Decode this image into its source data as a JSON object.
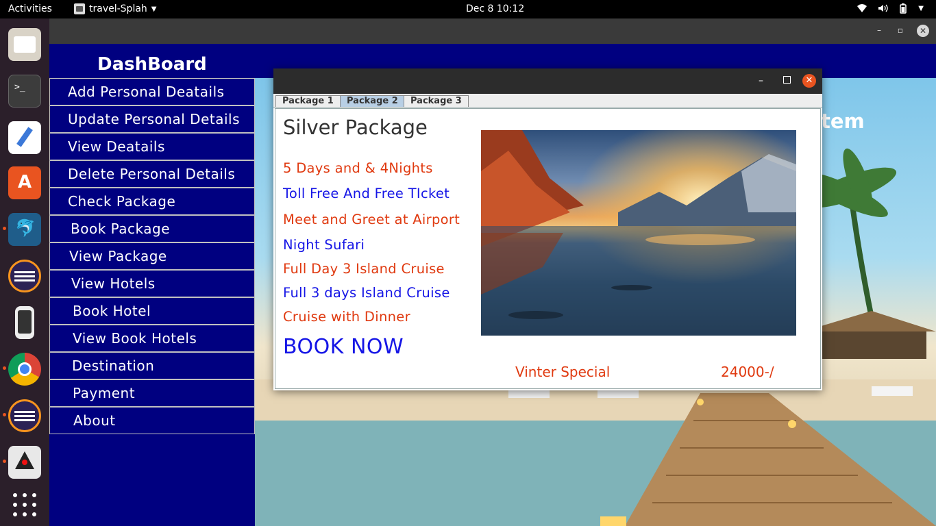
{
  "topbar": {
    "activities": "Activities",
    "app_name": "travel-Splah",
    "clock": "Dec 8  10:12"
  },
  "dock": {
    "items": [
      "files-icon",
      "terminal-icon",
      "text-editor-icon",
      "app-store-icon",
      "mysql-workbench-icon",
      "eclipse-icon",
      "kde-connect-icon",
      "chrome-icon",
      "eclipse-icon-2",
      "java-icon",
      "show-apps-icon"
    ]
  },
  "dashboard": {
    "title": "DashBoard",
    "menu": [
      "Add Personal Deatails",
      "Update Personal Details",
      "View Deatails",
      "Delete Personal Details",
      "Check Package",
      "Book Package",
      "View Package",
      "View Hotels",
      "Book Hotel",
      "View Book Hotels",
      "Destination",
      "Payment",
      "About"
    ],
    "background_title_fragment": "tem"
  },
  "dialog": {
    "tabs": [
      "Package 1",
      "Package 2",
      "Package 3"
    ],
    "active_tab": "Package 2",
    "package_title": "Silver Package",
    "features": [
      {
        "text": "5 Days and & 4Nights",
        "color": "#e03a10"
      },
      {
        "text": "Toll Free And Free TIcket",
        "color": "#1515e6"
      },
      {
        "text": "Meet and Greet at Airport",
        "color": "#e03a10"
      },
      {
        "text": "Night Sufari",
        "color": "#1515e6"
      },
      {
        "text": "Full Day 3 Island Cruise",
        "color": "#e03a10"
      },
      {
        "text": "Full 3 days Island Cruise",
        "color": "#1515e6"
      },
      {
        "text": "Cruise with Dinner",
        "color": "#e03a10"
      }
    ],
    "book_now": "BOOK NOW",
    "special_label": "Vinter Special",
    "price": "24000-/"
  },
  "colors": {
    "frame_bg": "#000080",
    "accent_orange": "#e95420",
    "text_red": "#e03a10",
    "text_blue": "#1515e6"
  }
}
